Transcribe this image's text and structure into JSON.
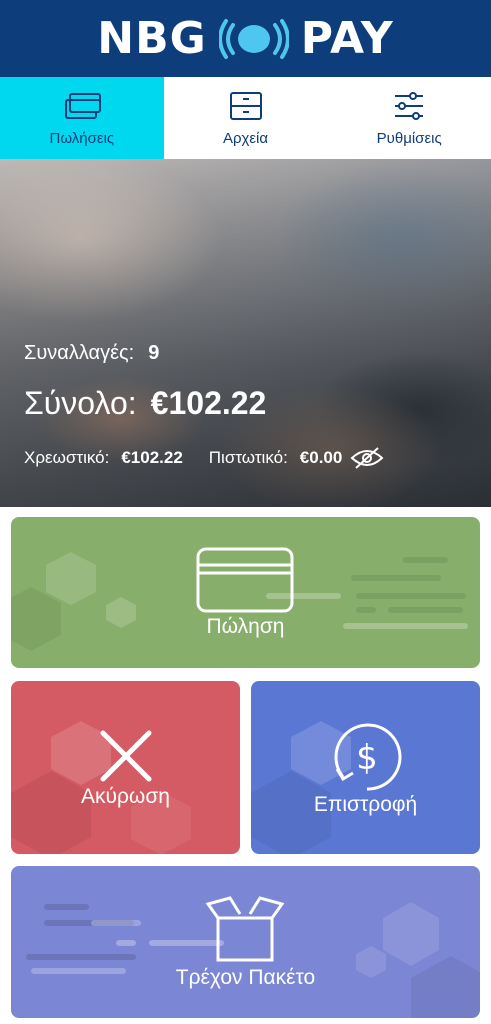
{
  "header": {
    "brand_left": "NBG",
    "brand_right": "PAY"
  },
  "tabs": [
    {
      "label": "Πωλήσεις",
      "icon": "cards-icon",
      "active": true
    },
    {
      "label": "Αρχεία",
      "icon": "drawer-icon",
      "active": false
    },
    {
      "label": "Ρυθμίσεις",
      "icon": "sliders-icon",
      "active": false
    }
  ],
  "summary": {
    "transactions_label": "Συναλλαγές:",
    "transactions_value": "9",
    "total_label": "Σύνολο:",
    "total_value": "€102.22",
    "debit_label": "Χρεωστικό:",
    "debit_value": "€102.22",
    "credit_label": "Πιστωτικό:",
    "credit_value": "€0.00"
  },
  "actions": {
    "sale": "Πώληση",
    "cancel": "Ακύρωση",
    "refund": "Επιστροφή",
    "batch": "Τρέχον Πακέτο"
  },
  "colors": {
    "header": "#0d3d7a",
    "active_tab": "#00d8f0",
    "sale": "#87ae6a",
    "cancel": "#d45a63",
    "refund": "#5b77d4",
    "batch": "#7b86d4"
  }
}
